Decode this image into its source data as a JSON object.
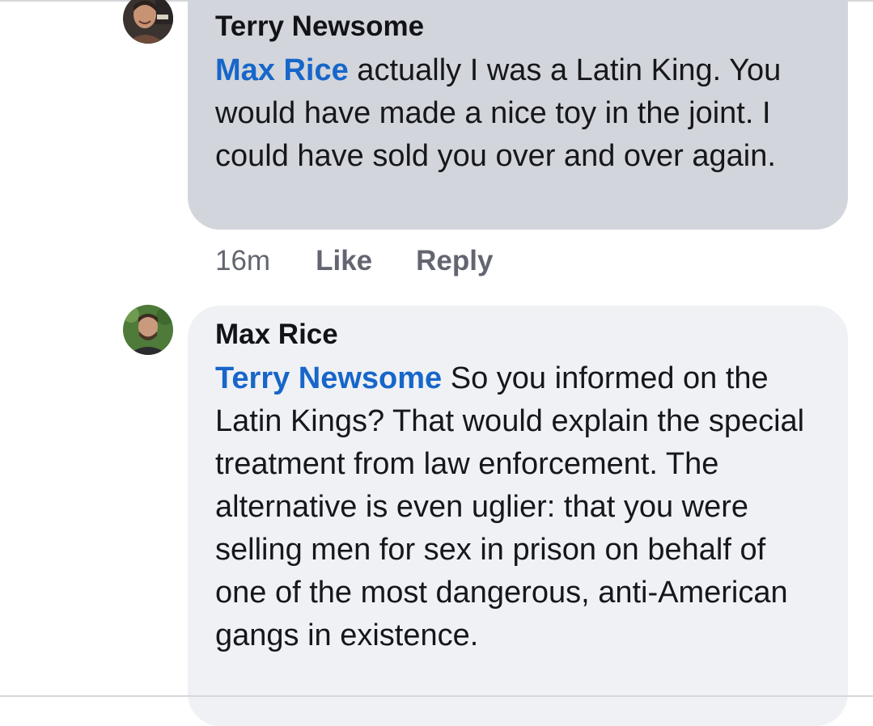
{
  "comments": [
    {
      "author": "Terry Newsome",
      "mention": "Max Rice",
      "text": " actually I was a Latin King. You would have made a nice toy in the joint.  I could have sold you over and over again.",
      "avatar_icon": "user-avatar-photo",
      "bubble_color": "#d2d5db",
      "actions": {
        "timestamp": "16m",
        "like_label": "Like",
        "reply_label": "Reply"
      }
    },
    {
      "author": "Max Rice",
      "mention": "Terry Newsome",
      "text": " So you informed on the Latin Kings? That would explain the special treatment from law enforcement. The alternative is even uglier: that you were selling men for sex in prison on behalf of one of the most dangerous, anti-American gangs in existence.",
      "avatar_icon": "user-avatar-photo",
      "bubble_color": "#eff1f5"
    }
  ],
  "colors": {
    "mention": "#1766c9",
    "secondary_text": "#636670"
  }
}
